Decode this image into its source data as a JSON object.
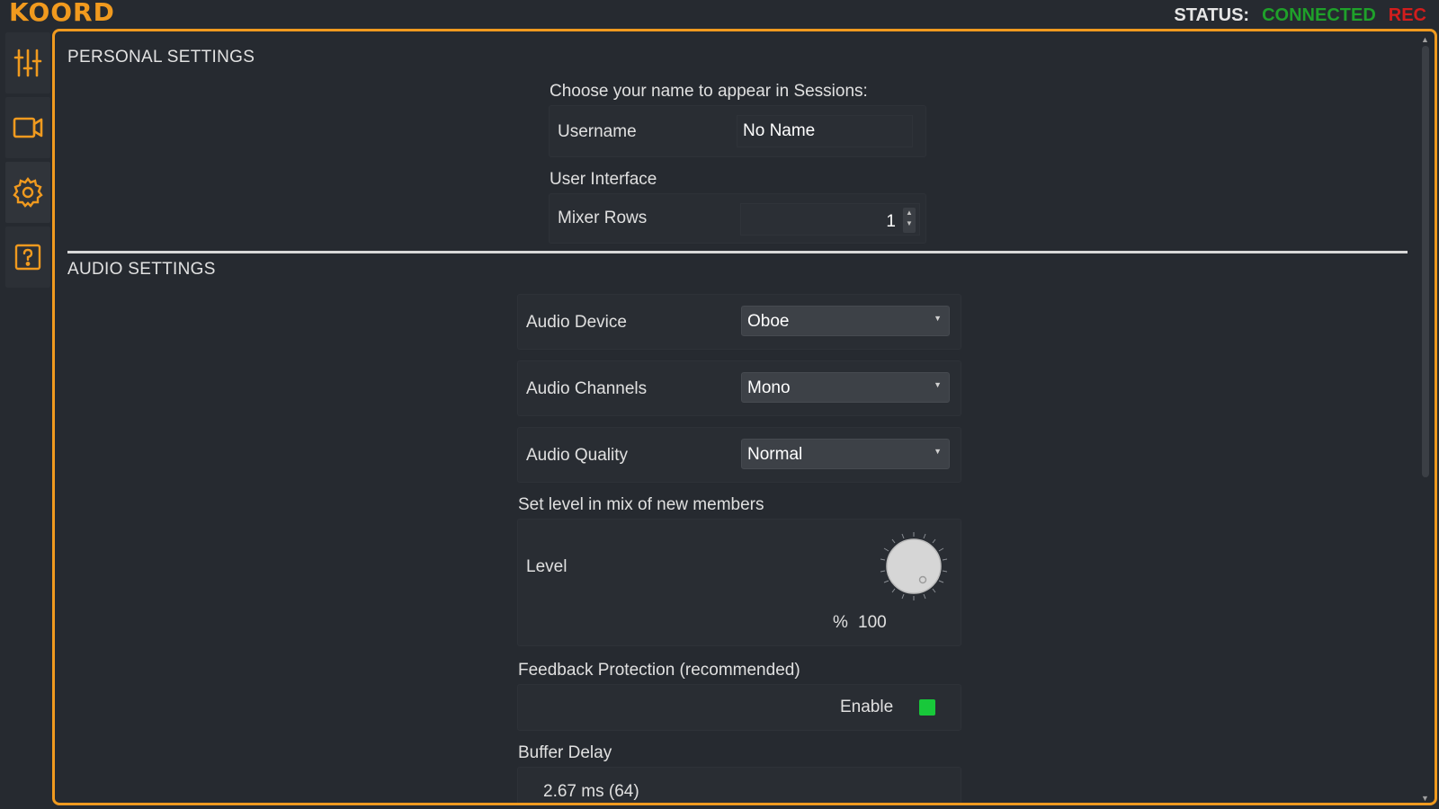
{
  "app": {
    "logo": "KOORD"
  },
  "status": {
    "label": "STATUS:",
    "connection": "CONNECTED",
    "rec": "REC"
  },
  "nav": [
    {
      "icon": "mixer-sliders-icon"
    },
    {
      "icon": "video-camera-icon"
    },
    {
      "icon": "gear-icon"
    },
    {
      "icon": "help-icon"
    }
  ],
  "personal": {
    "title": "PERSONAL SETTINGS",
    "name_prompt": "Choose your name to appear in Sessions:",
    "username_label": "Username",
    "username_value": "No Name",
    "ui_label": "User Interface",
    "mixer_rows_label": "Mixer Rows",
    "mixer_rows_value": "1"
  },
  "audio": {
    "title": "AUDIO SETTINGS",
    "device_label": "Audio Device",
    "device_value": "Oboe",
    "channels_label": "Audio Channels",
    "channels_value": "Mono",
    "quality_label": "Audio Quality",
    "quality_value": "Normal",
    "level_prompt": "Set level in mix of new members",
    "level_label": "Level",
    "level_unit": "%",
    "level_value": "100",
    "feedback_label": "Feedback Protection (recommended)",
    "enable_label": "Enable",
    "buffer_label": "Buffer Delay",
    "buffer_value": "2.67 ms (64)"
  },
  "colors": {
    "accent": "#f09a1f",
    "connected": "#1fa12a",
    "rec": "#d21d1d",
    "checkbox": "#18c83a"
  }
}
